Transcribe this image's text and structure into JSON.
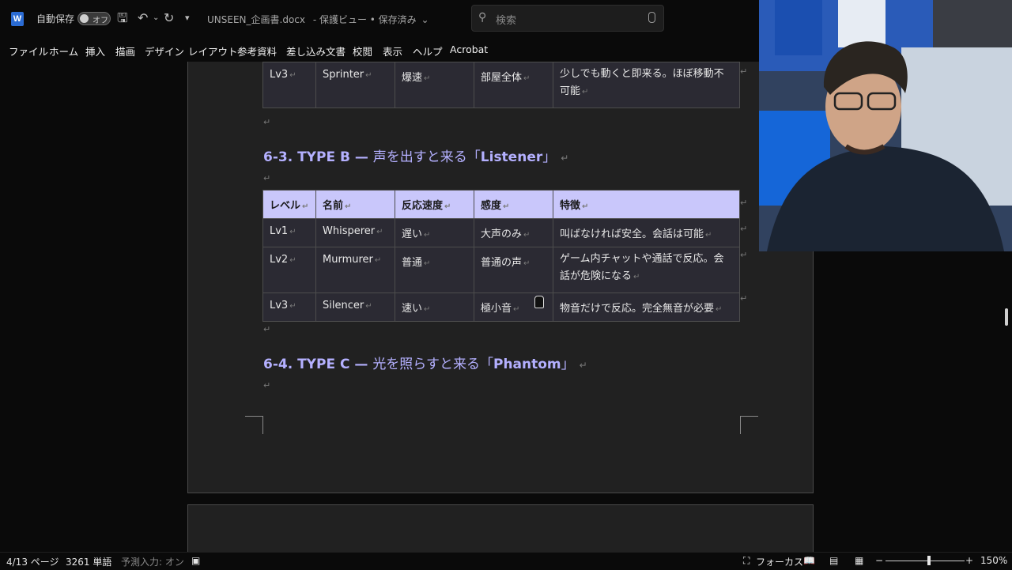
{
  "titlebar": {
    "app_icon": "word-icon",
    "autosave_label": "自動保存",
    "autosave_state": "オフ",
    "document_title": "UNSEEN_企画書.docx",
    "document_status": "- 保護ビュー • 保存済み",
    "search_placeholder": "検索"
  },
  "menu": [
    "ファイル",
    "ホーム",
    "挿入",
    "描画",
    "デザイン",
    "レイアウト",
    "参考資料",
    "差し込み文書",
    "校閲",
    "表示",
    "ヘルプ",
    "Acrobat"
  ],
  "document": {
    "top_row": {
      "level": "Lv3",
      "name": "Sprinter",
      "speed": "爆速",
      "sensitivity": "部屋全体",
      "feature": "少しでも動くと即来る。ほぼ移動不可能"
    },
    "section_b": {
      "heading_num": "6-3. TYPE B — ",
      "heading_jp": "声を出すと来る「",
      "heading_name": "Listener",
      "heading_close": "」"
    },
    "table_b": {
      "headers": [
        "レベル",
        "名前",
        "反応速度",
        "感度",
        "特徴"
      ],
      "rows": [
        [
          "Lv1",
          "Whisperer",
          "遅い",
          "大声のみ",
          "叫ばなければ安全。会話は可能"
        ],
        [
          "Lv2",
          "Murmurer",
          "普通",
          "普通の声",
          "ゲーム内チャットや通話で反応。会話が危険になる"
        ],
        [
          "Lv3",
          "Silencer",
          "速い",
          "極小音",
          "物音だけで反応。完全無音が必要"
        ]
      ]
    },
    "section_c": {
      "heading_num": "6-4. TYPE C — ",
      "heading_jp": "光を照らすと来る「",
      "heading_name": "Phantom",
      "heading_close": "」"
    },
    "paragraph_mark": "↵"
  },
  "statusbar": {
    "page": "4/13 ページ",
    "words": "3261 単語",
    "predictive": "予測入力: オン",
    "focus": "フォーカス",
    "zoom": "150%"
  }
}
